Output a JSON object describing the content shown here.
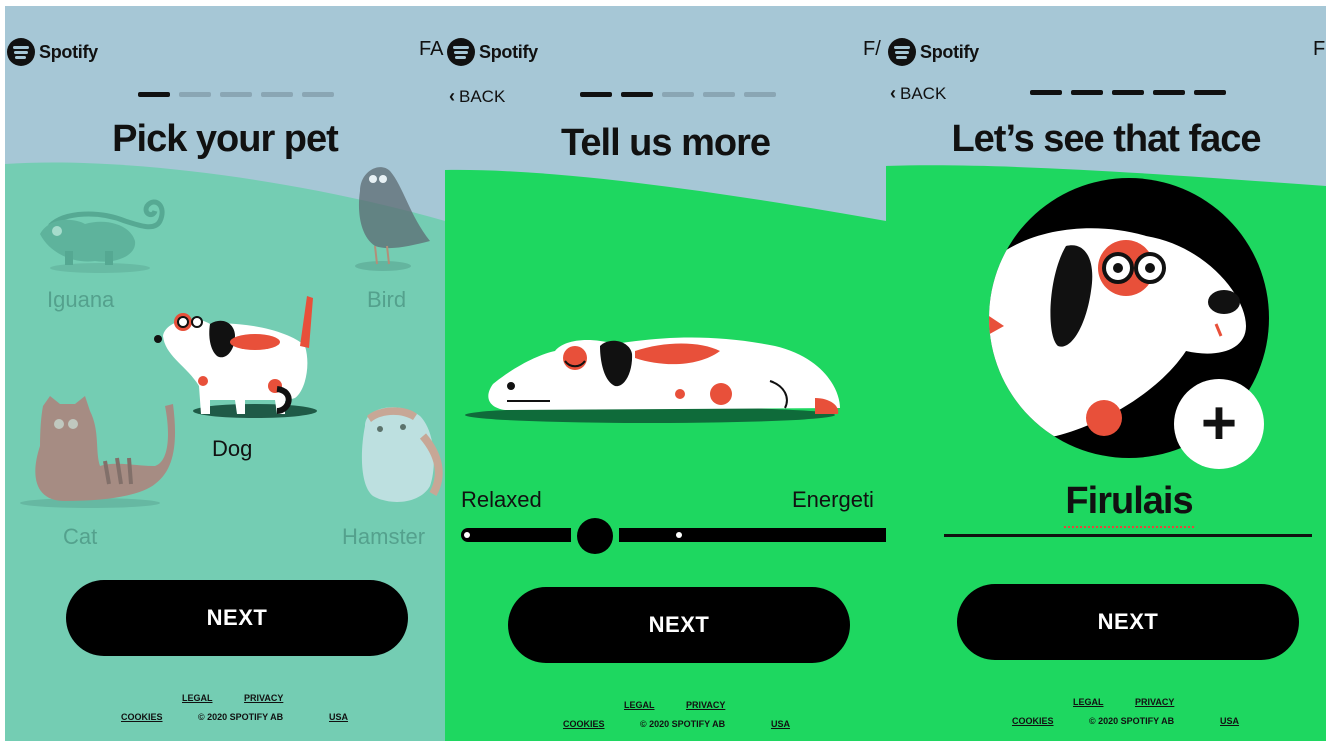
{
  "brand": {
    "name": "Spotify",
    "tm": "™"
  },
  "screens": [
    {
      "corner_text": "FA",
      "title": "Pick your pet",
      "progress": [
        true,
        false,
        false,
        false,
        false
      ],
      "pets": {
        "iguana": "Iguana",
        "bird": "Bird",
        "dog": "Dog",
        "cat": "Cat",
        "hamster": "Hamster"
      },
      "selected_pet": "Dog",
      "next_label": "NEXT",
      "footer": {
        "legal": "LEGAL",
        "privacy": "PRIVACY",
        "cookies": "COOKIES",
        "copyright": "© 2020 SPOTIFY AB",
        "region": "USA"
      }
    },
    {
      "corner_text": "F/",
      "back_label": "BACK",
      "title": "Tell us more",
      "progress": [
        true,
        true,
        false,
        false,
        false
      ],
      "slider": {
        "left_label": "Relaxed",
        "right_label": "Energeti"
      },
      "next_label": "NEXT",
      "footer": {
        "legal": "LEGAL",
        "privacy": "PRIVACY",
        "cookies": "COOKIES",
        "copyright": "© 2020 SPOTIFY AB",
        "region": "USA"
      }
    },
    {
      "corner_text": "F",
      "back_label": "BACK",
      "title": "Let’s see that face",
      "progress": [
        true,
        true,
        true,
        true,
        true
      ],
      "pet_name": "Firulais",
      "next_label": "NEXT",
      "footer": {
        "legal": "LEGAL",
        "privacy": "PRIVACY",
        "cookies": "COOKIES",
        "copyright": "© 2020 SPOTIFY AB",
        "region": "USA"
      }
    }
  ],
  "colors": {
    "sky": "#a6c7d6",
    "mint": "#74cdb3",
    "green": "#1ed760",
    "black": "#000000",
    "spot_red": "#e8503a"
  }
}
